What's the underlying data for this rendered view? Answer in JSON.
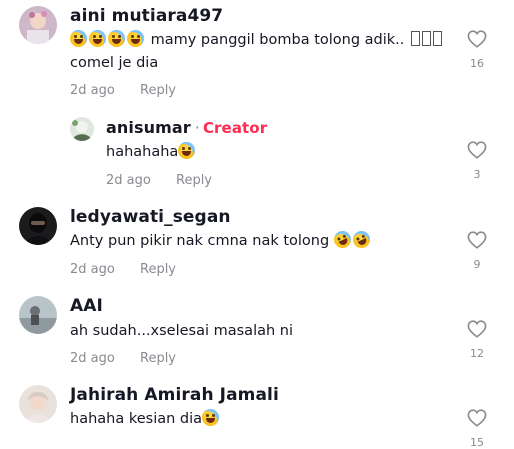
{
  "comments": [
    {
      "username": "aini mutiara497",
      "text_line1": "mamy panggil bomba tolong adik..",
      "text_line2": "comel je dia",
      "time": "2d ago",
      "reply_label": "Reply",
      "likes": "16",
      "emoji_prefix_count": 4
    },
    {
      "username": "anisumar",
      "creator_label": "Creator",
      "text": "hahahaha",
      "time": "2d ago",
      "reply_label": "Reply",
      "likes": "3"
    },
    {
      "username": "ledyawati_segan",
      "text": "Anty pun pikir nak cmna nak tolong",
      "time": "2d ago",
      "reply_label": "Reply",
      "likes": "9"
    },
    {
      "username": "AAI",
      "text": "ah sudah...xselesai masalah ni",
      "time": "2d ago",
      "reply_label": "Reply",
      "likes": "12"
    },
    {
      "username": "Jahirah Amirah Jamali",
      "text": "hahaha kesian dia",
      "likes": "15"
    }
  ],
  "icons": {
    "like": "heart-outline-icon"
  }
}
